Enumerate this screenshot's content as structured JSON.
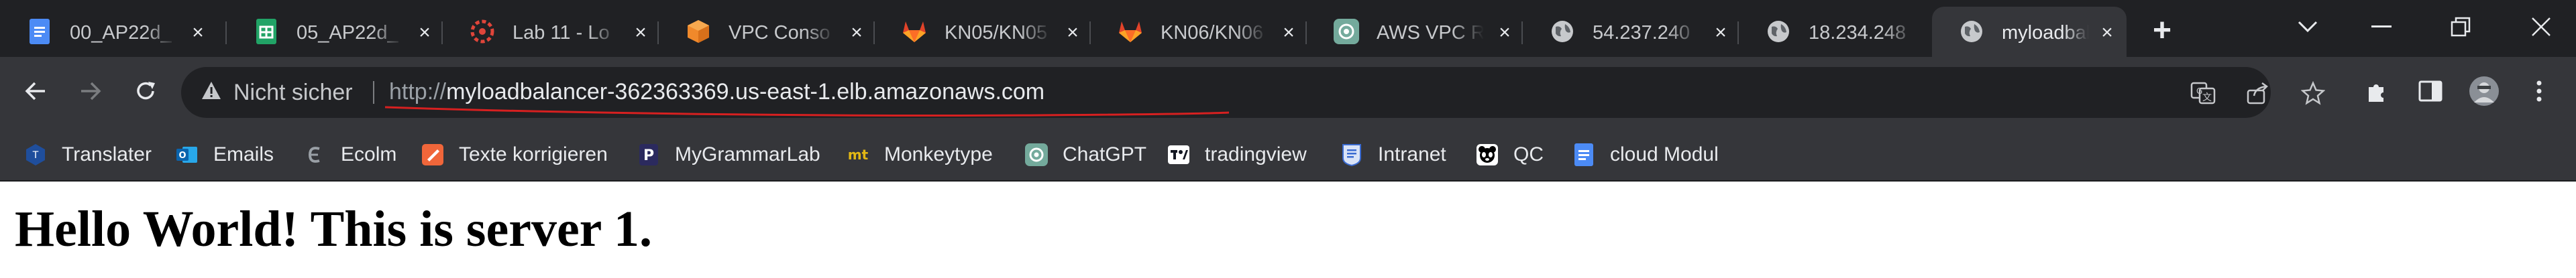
{
  "tabs": [
    {
      "title": "00_AP22d_",
      "icon": "google-docs-icon",
      "close": "×"
    },
    {
      "title": "05_AP22d_",
      "icon": "google-sheets-icon",
      "close": "×"
    },
    {
      "title": "Lab 11 - Lo",
      "icon": "lab-ring-icon",
      "close": "×"
    },
    {
      "title": "VPC Conso",
      "icon": "aws-cube-icon",
      "close": "×"
    },
    {
      "title": "KN05/KN05",
      "icon": "gitlab-icon",
      "close": "×"
    },
    {
      "title": "KN06/KN06",
      "icon": "gitlab-icon",
      "close": "×"
    },
    {
      "title": "AWS VPC R",
      "icon": "chatgpt-icon",
      "close": "×"
    },
    {
      "title": "54.237.240",
      "icon": "globe-icon",
      "close": "×"
    },
    {
      "title": "18.234.248",
      "icon": "globe-icon",
      "close": "×"
    },
    {
      "title": "myloadbal",
      "icon": "globe-icon",
      "close": "×"
    }
  ],
  "tabstrip": {
    "new_tab": "+"
  },
  "omnibox": {
    "security_label": "Nicht sicher",
    "url_scheme": "http://",
    "url_host": "myloadbalancer-362363369.us-east-1.elb.amazonaws.com"
  },
  "bookmarks": [
    {
      "label": "Translater",
      "icon": "translater-icon"
    },
    {
      "label": "Emails",
      "icon": "outlook-icon"
    },
    {
      "label": "Ecolm",
      "icon": "ecolm-icon"
    },
    {
      "label": "Texte korrigieren",
      "icon": "text-correct-icon"
    },
    {
      "label": "MyGrammarLab",
      "icon": "pearson-icon"
    },
    {
      "label": "Monkeytype",
      "icon": "monkeytype-icon"
    },
    {
      "label": "ChatGPT",
      "icon": "chatgpt-icon"
    },
    {
      "label": "tradingview",
      "icon": "tradingview-icon"
    },
    {
      "label": "Intranet",
      "icon": "intranet-icon"
    },
    {
      "label": "QC",
      "icon": "qc-icon"
    },
    {
      "label": "cloud Modul",
      "icon": "google-docs-icon"
    }
  ],
  "page": {
    "heading": "Hello World! This is server 1."
  },
  "colors": {
    "tabstrip_bg": "#202124",
    "toolbar_bg": "#35363a",
    "omnibox_bg": "#202124",
    "annotation_red": "#d62020"
  }
}
